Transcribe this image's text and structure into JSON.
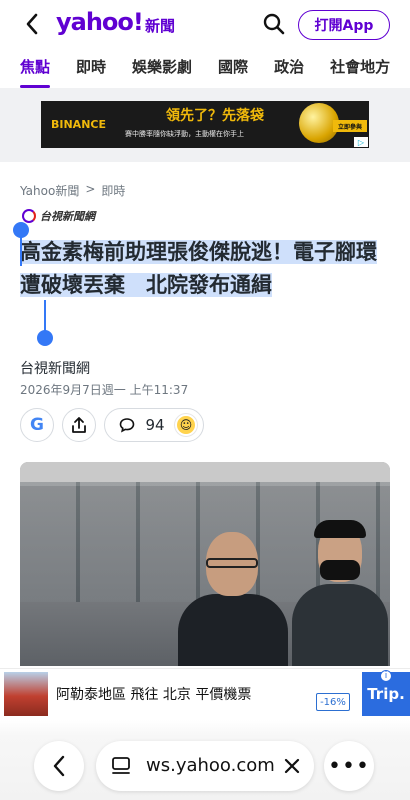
{
  "header": {
    "logo": "yahoo!",
    "logo_sub": "新聞",
    "open_app": "打開App"
  },
  "tabs": [
    {
      "label": "焦點",
      "active": true
    },
    {
      "label": "即時",
      "active": false
    },
    {
      "label": "娛樂影劇",
      "active": false
    },
    {
      "label": "國際",
      "active": false
    },
    {
      "label": "政治",
      "active": false
    },
    {
      "label": "社會地方",
      "active": false
    }
  ],
  "top_ad": {
    "brand": "BINANCE",
    "title": "領先了？先落袋",
    "subtitle": "賽中勝率隨你缺浮動，主動權在你手上",
    "cta": "立即參與"
  },
  "article": {
    "breadcrumb": [
      "Yahoo新聞",
      ">",
      "即時"
    ],
    "source_logo_text": "台視新聞網",
    "headline": "高金素梅前助理張俊傑脫逃！電子腳環遭破壞丟棄　北院發布通緝",
    "author": "台視新聞網",
    "date": "2026年9月7日週一 上午11:37",
    "comment_count": "94"
  },
  "bottom_ad": {
    "text": "阿勒泰地區 飛往 北京 平價機票",
    "badge": "-16%",
    "brand": "Trip."
  },
  "browser": {
    "url": "ws.yahoo.com"
  },
  "colors": {
    "brand": "#6001d2",
    "selection": "#cfe0fb",
    "handle": "#3478f6"
  }
}
